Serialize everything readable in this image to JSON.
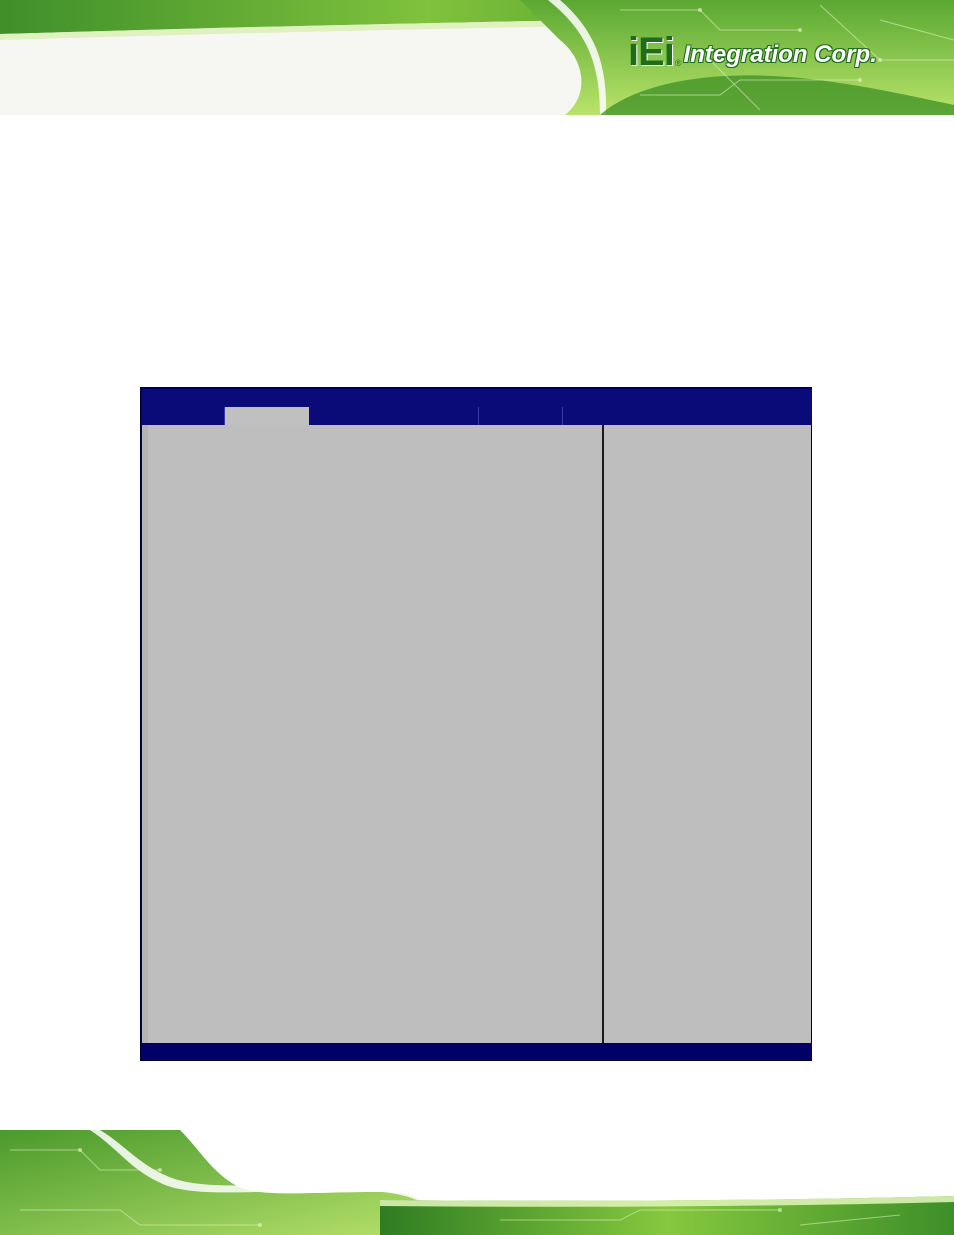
{
  "brand": {
    "logo_mark": "iEi",
    "registered_symbol": "®",
    "company_name": "Integration Corp."
  },
  "colors": {
    "banner_green_dark": "#1f6d1a",
    "banner_green_light": "#a8d64a",
    "bios_blue": "#000066",
    "bios_gray": "#bebebe"
  },
  "bios": {
    "menu_tabs": [
      {
        "label": "",
        "active": false
      },
      {
        "label": "",
        "active": true
      },
      {
        "label": "",
        "active": false
      },
      {
        "label": "",
        "active": false
      },
      {
        "label": "",
        "active": false
      }
    ],
    "main_panel_text": "",
    "help_panel_text": "",
    "status_text": ""
  }
}
